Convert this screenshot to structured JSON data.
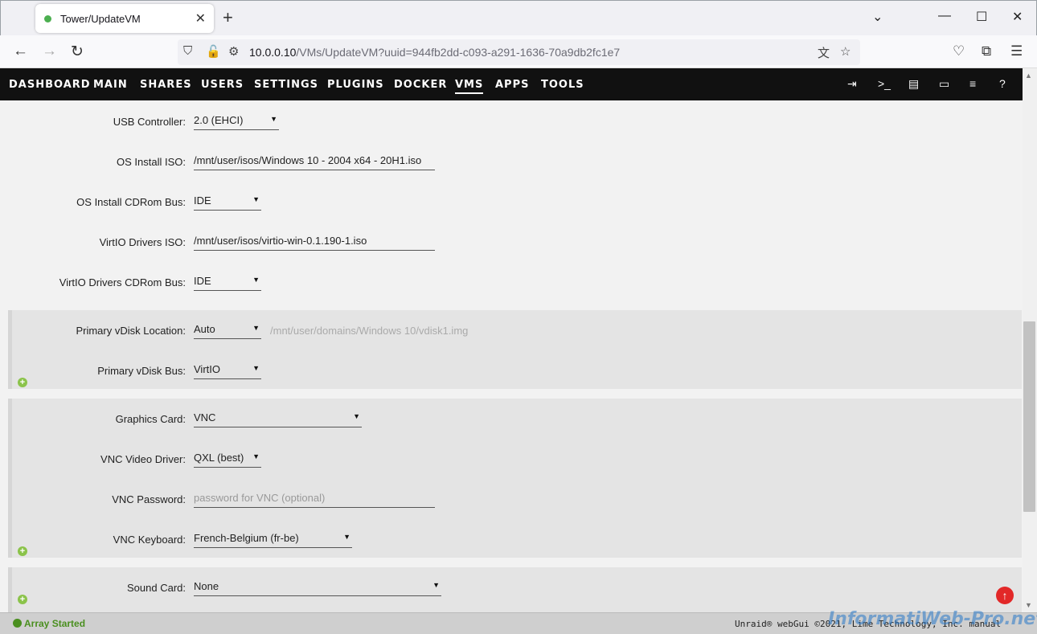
{
  "browser": {
    "tab_title": "Tower/UpdateVM",
    "url_host": "10.0.0.10",
    "url_path": "/VMs/UpdateVM?uuid=944fb2dd-c093-a291-1636-70a9db2fc1e7"
  },
  "menu": {
    "items": [
      "DASHBOARD",
      "MAIN",
      "SHARES",
      "USERS",
      "SETTINGS",
      "PLUGINS",
      "DOCKER",
      "VMS",
      "APPS",
      "TOOLS"
    ],
    "active": "VMS"
  },
  "form": {
    "usb_controller": {
      "label": "USB Controller:",
      "value": "2.0 (EHCI)"
    },
    "os_install_iso": {
      "label": "OS Install ISO:",
      "value": "/mnt/user/isos/Windows 10 - 2004 x64 - 20H1.iso"
    },
    "os_install_cdrom_bus": {
      "label": "OS Install CDRom Bus:",
      "value": "IDE"
    },
    "virtio_drivers_iso": {
      "label": "VirtIO Drivers ISO:",
      "value": "/mnt/user/isos/virtio-win-0.1.190-1.iso"
    },
    "virtio_drivers_cdrom_bus": {
      "label": "VirtIO Drivers CDRom Bus:",
      "value": "IDE"
    },
    "primary_vdisk_location": {
      "label": "Primary vDisk Location:",
      "value": "Auto",
      "hint": "/mnt/user/domains/Windows 10/vdisk1.img"
    },
    "primary_vdisk_bus": {
      "label": "Primary vDisk Bus:",
      "value": "VirtIO"
    },
    "graphics_card": {
      "label": "Graphics Card:",
      "value": "VNC"
    },
    "vnc_video_driver": {
      "label": "VNC Video Driver:",
      "value": "QXL (best)"
    },
    "vnc_password": {
      "label": "VNC Password:",
      "placeholder": "password for VNC (optional)"
    },
    "vnc_keyboard": {
      "label": "VNC Keyboard:",
      "value": "French-Belgium (fr-be)"
    },
    "sound_card": {
      "label": "Sound Card:",
      "value": "None"
    }
  },
  "footer": {
    "status": "Array Started",
    "copyright": "Unraid® webGui ©2021, Lime Technology, Inc. manual"
  },
  "watermark": "InformatiWeb-Pro.net"
}
